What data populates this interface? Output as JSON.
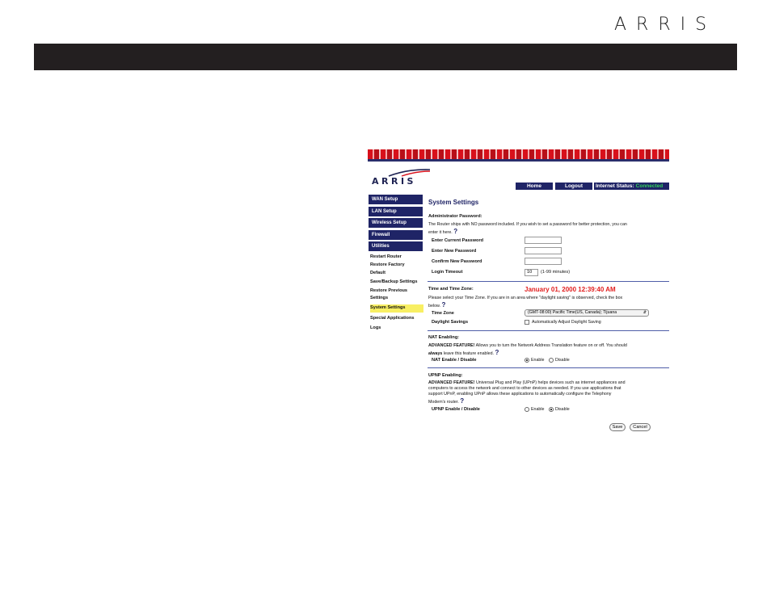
{
  "doc": {
    "logo_text": "ARRIS"
  },
  "router": {
    "logo_text": "ARRIS",
    "top": {
      "home": "Home",
      "logout": "Logout",
      "status_label": "Internet Status:",
      "status_value": "Connected"
    },
    "nav": [
      "WAN Setup",
      "LAN Setup",
      "Wireless Setup",
      "Firewall",
      "Utilities"
    ],
    "subnav": [
      "Restart Router",
      "Restore Factory",
      "Default",
      "Save/Backup Settings",
      "Restore Previous",
      "Settings",
      "System Settings",
      "Special Applications",
      "Logs"
    ],
    "page_title": "System Settings",
    "admin": {
      "heading": "Administrator Password:",
      "desc1": "The Router ships with NO password included. If you wish to set a password for better protection, you can",
      "desc2": "enter it here.",
      "current_label": "Enter Current Password",
      "new_label": "Enter New Password",
      "confirm_label": "Confirm New Password",
      "timeout_label": "Login Timeout",
      "timeout_value": "10",
      "timeout_hint": "(1-99 minutes)"
    },
    "time": {
      "heading": "Time and Time Zone:",
      "date": "January 01, 2000    12:39:40 AM",
      "desc1": "Please select your Time Zone. If you are in an area where \"daylight saving\" is observed, check the box",
      "desc2": "below.",
      "zone_label": "Time Zone",
      "zone_value": "(GMT-08:00) Pacific Time(US, Canada); Tijuana",
      "dst_label": "Daylight Savings",
      "dst_option": "Automatically Adjust Daylight Saving"
    },
    "nat": {
      "heading": "NAT Enabling:",
      "adv": "ADVANCED FEATURE!",
      "desc1": " Allows you to turn the Network Address Translation feature on or off. You should",
      "always": "always",
      "desc2": " leave this feature enabled.",
      "label": "NAT Enable / Disable",
      "enable": "Enable",
      "disable": "Disable"
    },
    "upnp": {
      "heading": "UPNP Enabling:",
      "adv": "ADVANCED FEATURE!",
      "desc1": " Universal Plug and Play (UPnP) helps devices such as internet appliances and",
      "desc2": "computers to access the network and connect to other devices as needed. If you use applications that",
      "desc3": "support UPnP, enabling UPnP allows these applications to automatically configure the Telephony",
      "desc4": "Modem's router.",
      "label": "UPNP Enable / Disable",
      "enable": "Enable",
      "disable": "Disable"
    },
    "save": "Save",
    "cancel": "Cancel",
    "help_glyph": "?"
  }
}
